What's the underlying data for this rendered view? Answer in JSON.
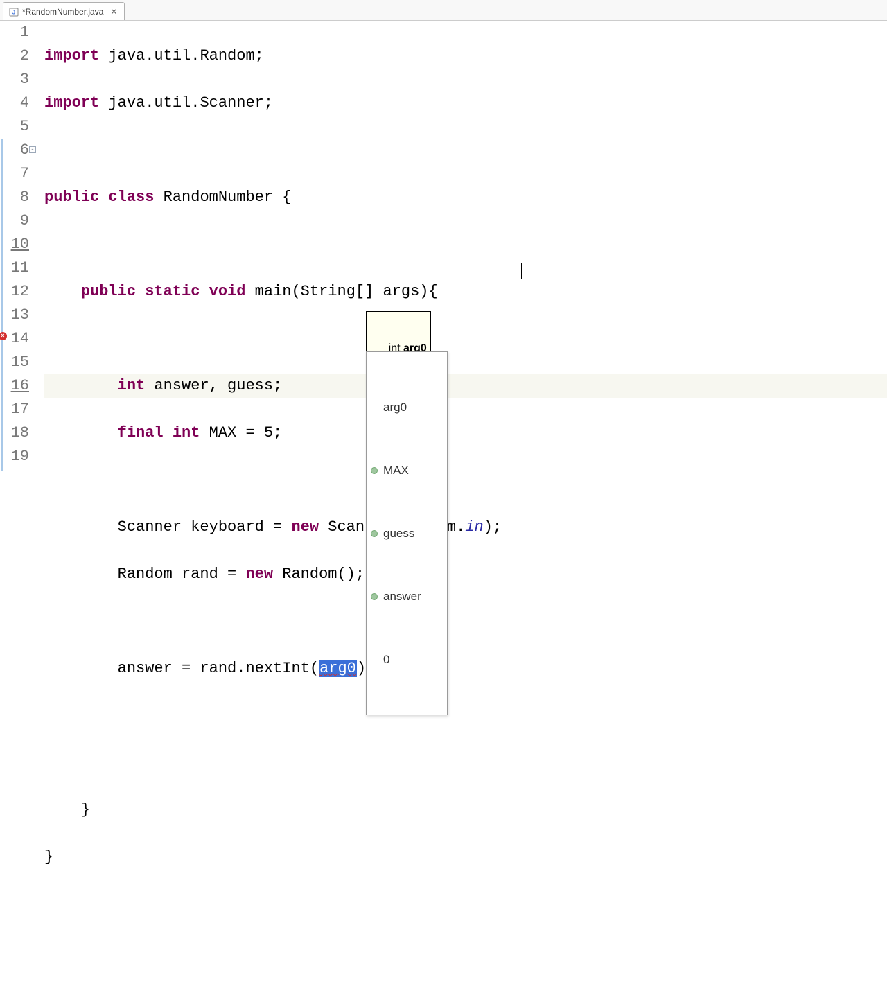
{
  "tab": {
    "label": "*RandomNumber.java",
    "close": "✕"
  },
  "gutter": {
    "lines": [
      "1",
      "2",
      "3",
      "4",
      "5",
      "6",
      "7",
      "8",
      "9",
      "10",
      "11",
      "12",
      "13",
      "14",
      "15",
      "16",
      "17",
      "18",
      "19"
    ]
  },
  "code": {
    "l1_kw": "import",
    "l1_rest": " java.util.Random;",
    "l2_kw": "import",
    "l2_rest": " java.util.Scanner;",
    "l4_kw1": "public",
    "l4_kw2": "class",
    "l4_rest": " RandomNumber {",
    "l6_kw1": "public",
    "l6_kw2": "static",
    "l6_kw3": "void",
    "l6_rest": " main(String[] args){",
    "l8_kw": "int",
    "l8_rest": " answer, guess;",
    "l9_kw1": "final",
    "l9_kw2": "int",
    "l9_rest": " MAX = 5;",
    "l11_a": "        Scanner keyboard = ",
    "l11_kw": "new",
    "l11_b": " Scanner(System.",
    "l11_it": "in",
    "l11_c": ");",
    "l12_a": "        Random rand = ",
    "l12_kw": "new",
    "l12_b": " Random();",
    "l14_a": "        answer = rand.nextInt(",
    "l14_sel": "arg0",
    "l14_b": ")",
    "l17_brace": "    }",
    "l18_brace": "}"
  },
  "tooltip": {
    "prefix": "int ",
    "bold": "arg0"
  },
  "suggest": {
    "items": [
      {
        "label": "arg0",
        "dot": false
      },
      {
        "label": "MAX",
        "dot": true
      },
      {
        "label": "guess",
        "dot": true
      },
      {
        "label": "answer",
        "dot": true
      },
      {
        "label": "0",
        "dot": false
      }
    ]
  }
}
